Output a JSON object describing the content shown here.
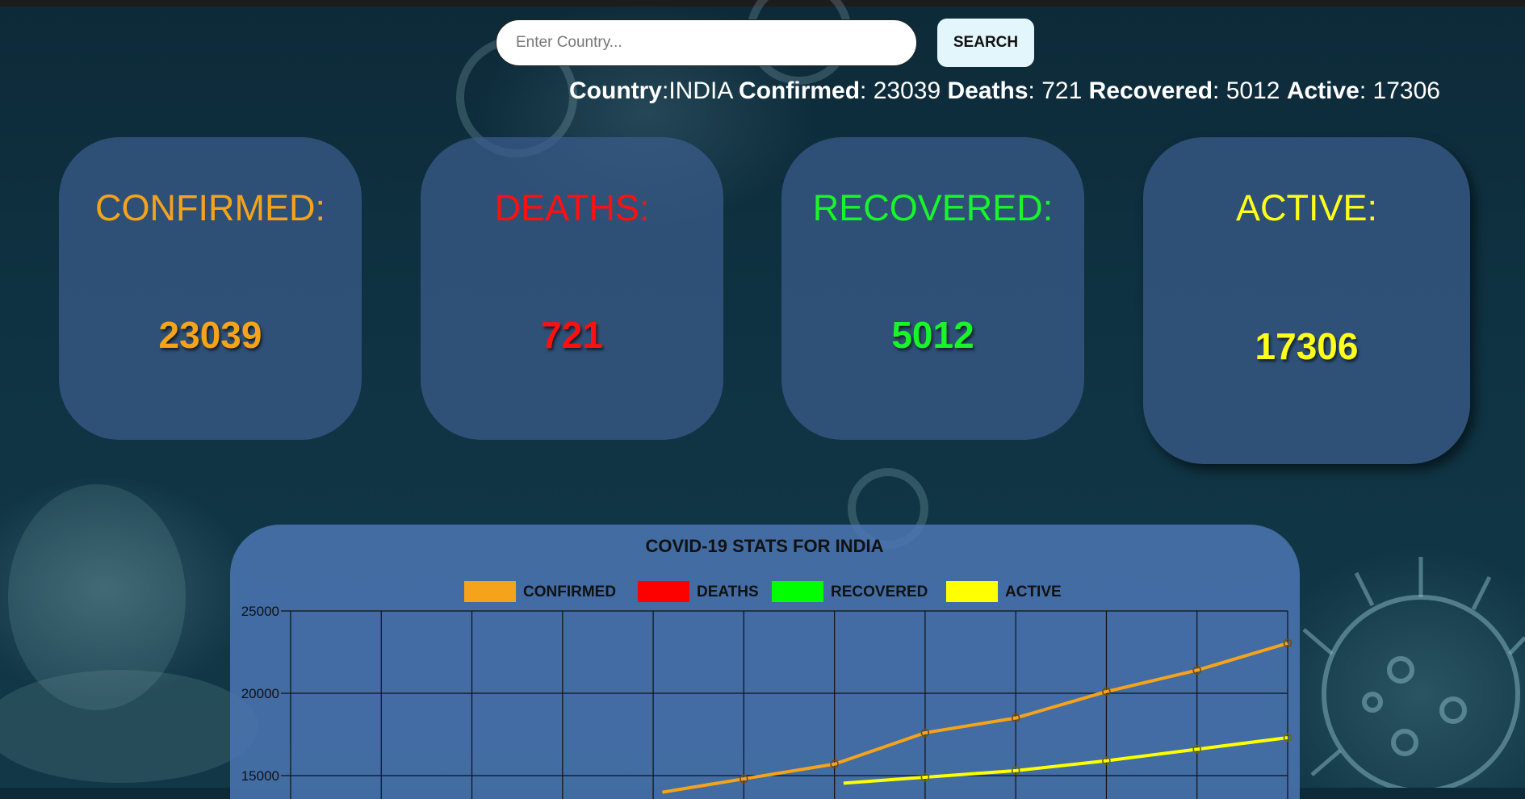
{
  "search": {
    "placeholder": "Enter Country...",
    "button_label": "SEARCH"
  },
  "summary": {
    "country_label": "Country",
    "country_value": "INDIA",
    "confirmed_label": "Confirmed",
    "confirmed_value": "23039",
    "deaths_label": "Deaths",
    "deaths_value": "721",
    "recovered_label": "Recovered",
    "recovered_value": "5012",
    "active_label": "Active",
    "active_value": "17306"
  },
  "cards": [
    {
      "label": "CONFIRMED:",
      "value": "23039",
      "color": "#f5a31b"
    },
    {
      "label": "DEATHS:",
      "value": "721",
      "color": "#ff1010"
    },
    {
      "label": "RECOVERED:",
      "value": "5012",
      "color": "#18f52a"
    },
    {
      "label": "ACTIVE:",
      "value": "17306",
      "color": "#ffff1a"
    }
  ],
  "chart_data": {
    "type": "line",
    "title": "COVID-19 STATS FOR INDIA",
    "xlabel": "",
    "ylabel": "",
    "ylim": [
      15000,
      25000
    ],
    "yticks": [
      "25000",
      "20000",
      "15000"
    ],
    "grid": true,
    "legend_position": "top",
    "x_count": 12,
    "series": [
      {
        "name": "CONFIRMED",
        "color": "#f5a31b",
        "values": [
          null,
          null,
          null,
          null,
          null,
          14800,
          15700,
          17600,
          18500,
          20100,
          21400,
          23039
        ]
      },
      {
        "name": "DEATHS",
        "color": "#ff0000",
        "values": [
          null,
          null,
          null,
          null,
          null,
          null,
          null,
          null,
          null,
          null,
          null,
          null
        ]
      },
      {
        "name": "RECOVERED",
        "color": "#00ff00",
        "values": [
          null,
          null,
          null,
          null,
          null,
          null,
          null,
          null,
          null,
          null,
          null,
          null
        ]
      },
      {
        "name": "ACTIVE",
        "color": "#ffff00",
        "values": [
          null,
          null,
          null,
          null,
          null,
          null,
          null,
          14900,
          15300,
          15900,
          16600,
          17306
        ]
      }
    ]
  }
}
